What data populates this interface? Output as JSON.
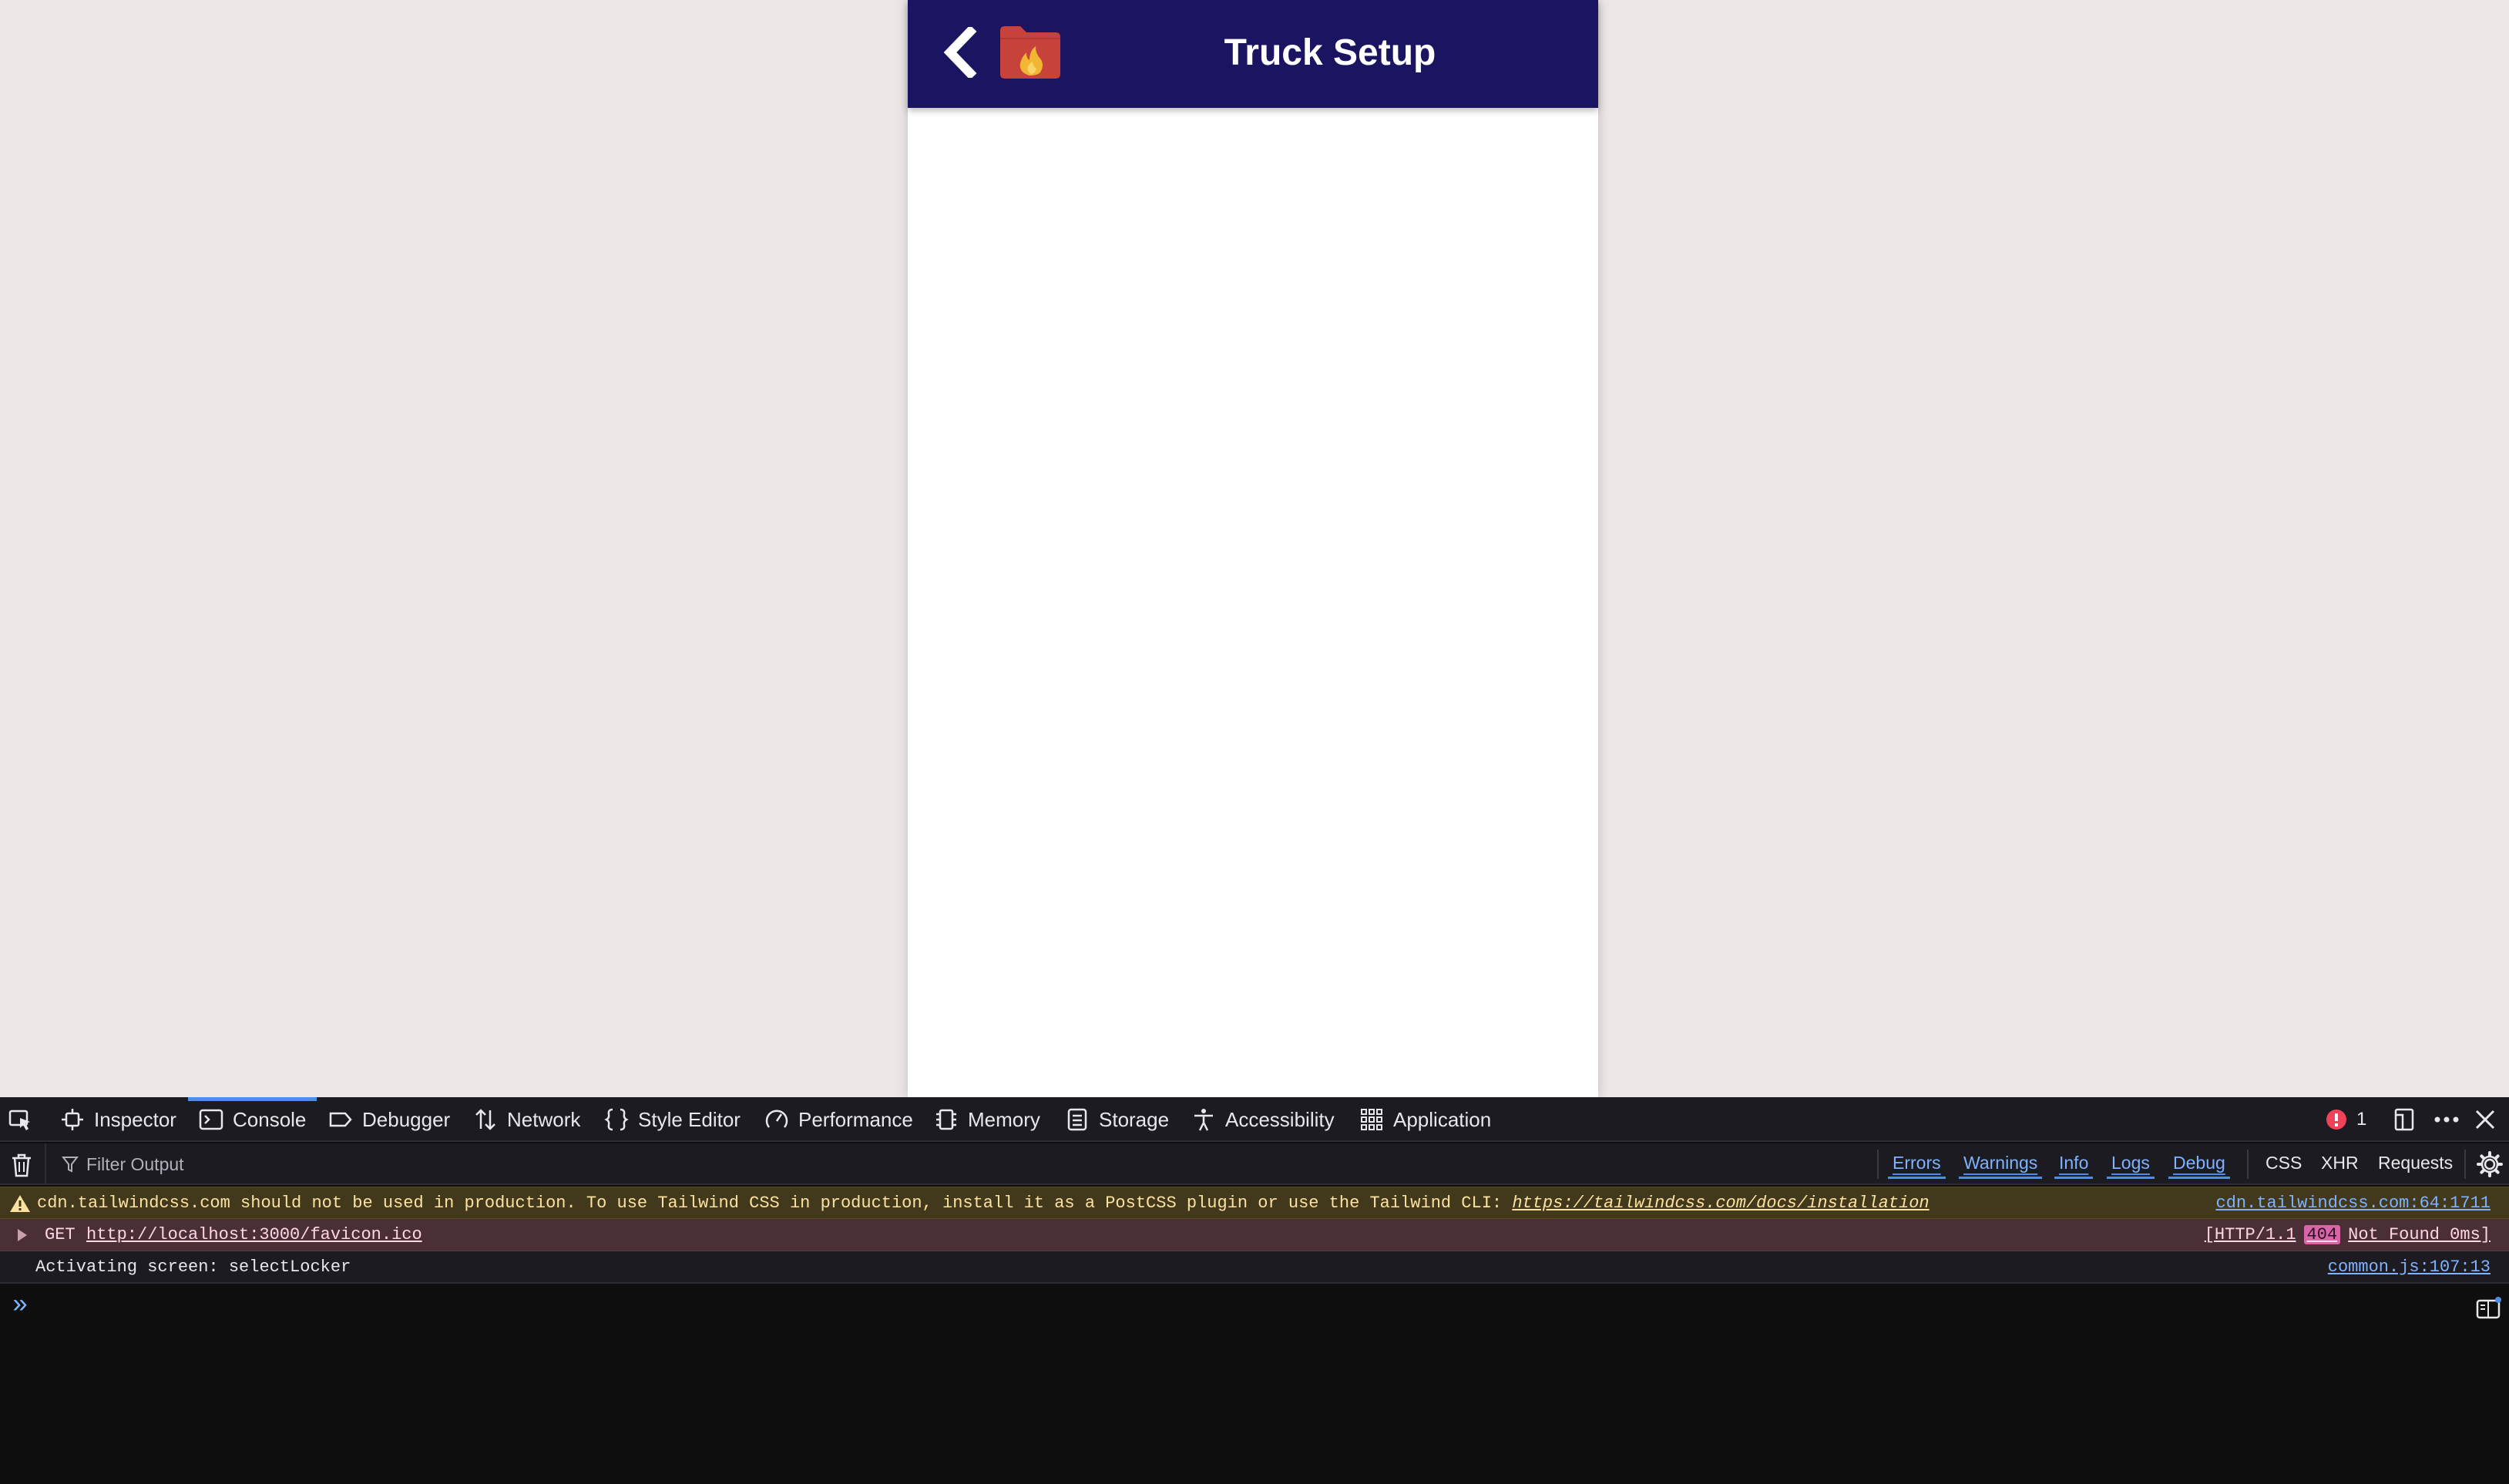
{
  "app": {
    "title": "Truck Setup",
    "header_color": "#1a1461",
    "back_icon": "chevron-left-icon",
    "logo_icon": "folder-flame-icon"
  },
  "devtools": {
    "tabs": [
      {
        "label": "Inspector",
        "icon": "inspector-icon"
      },
      {
        "label": "Console",
        "icon": "console-icon",
        "active": true
      },
      {
        "label": "Debugger",
        "icon": "debugger-icon"
      },
      {
        "label": "Network",
        "icon": "network-icon"
      },
      {
        "label": "Style Editor",
        "icon": "style-editor-icon"
      },
      {
        "label": "Performance",
        "icon": "performance-icon"
      },
      {
        "label": "Memory",
        "icon": "memory-icon"
      },
      {
        "label": "Storage",
        "icon": "storage-icon"
      },
      {
        "label": "Accessibility",
        "icon": "accessibility-icon"
      },
      {
        "label": "Application",
        "icon": "application-icon"
      }
    ],
    "error_count": "1",
    "filter_placeholder": "Filter Output",
    "filters": [
      "Errors",
      "Warnings",
      "Info",
      "Logs",
      "Debug"
    ],
    "extra_filters": [
      "CSS",
      "XHR",
      "Requests"
    ],
    "messages": [
      {
        "type": "warning",
        "text": "cdn.tailwindcss.com should not be used in production. To use Tailwind CSS in production, install it as a PostCSS plugin or use the Tailwind CLI: ",
        "link": "https://tailwindcss.com/docs/installation",
        "source": "cdn.tailwindcss.com:64:1711"
      },
      {
        "type": "error",
        "method": "GET",
        "url": "http://localhost:3000/favicon.ico",
        "status_prefix": "[HTTP/1.1",
        "status_code": "404",
        "status_suffix": "Not Found 0ms]"
      },
      {
        "type": "log",
        "text": "Activating screen: selectLocker",
        "source": "common.js:107:13"
      }
    ],
    "prompt_symbol": "»"
  }
}
